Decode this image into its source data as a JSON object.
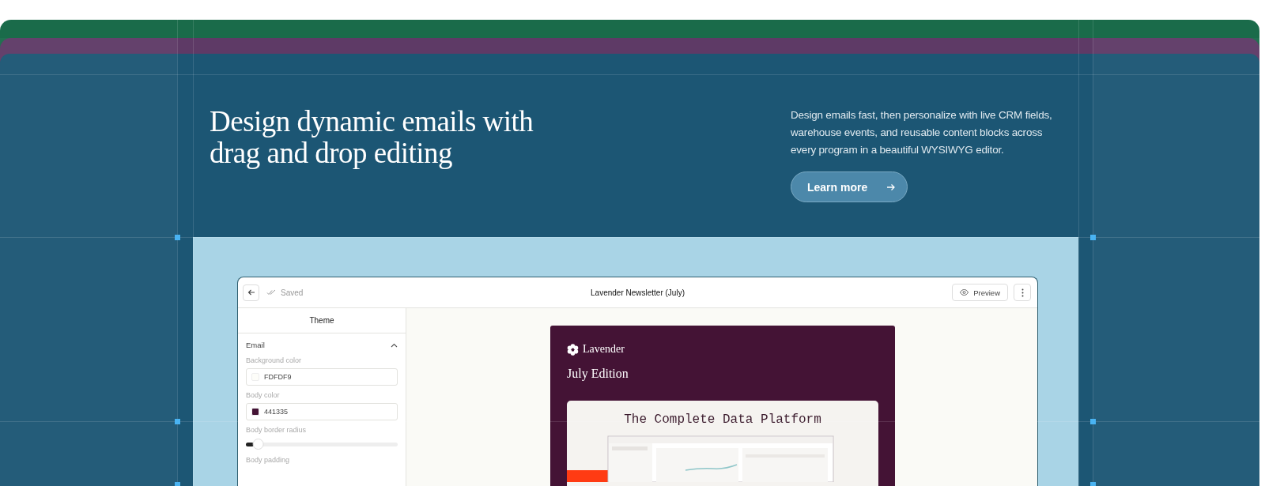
{
  "hero": {
    "heading": "Design dynamic emails with drag and drop editing",
    "description": "Design emails fast, then personalize with live CRM fields, warehouse events, and reusable content blocks across every program in a beautiful WYSIWYG editor.",
    "button": "Learn more"
  },
  "editor": {
    "status": "Saved",
    "title": "Lavender Newsletter (July)",
    "preview_button": "Preview",
    "panel_title": "Theme",
    "section": {
      "label": "Email",
      "expanded": true
    },
    "fields": [
      {
        "kind": "color",
        "label": "Background color",
        "value": "FDFDF9",
        "color": "#fdfdf9"
      },
      {
        "kind": "color",
        "label": "Body color",
        "value": "441335",
        "color": "#441335"
      },
      {
        "kind": "slider",
        "label": "Body border radius",
        "level": 0.05
      },
      {
        "kind": "label",
        "label": "Body padding"
      }
    ]
  },
  "email": {
    "brand": "Lavender",
    "heading": "July Edition",
    "banner_title": "The Complete Data Platform"
  }
}
